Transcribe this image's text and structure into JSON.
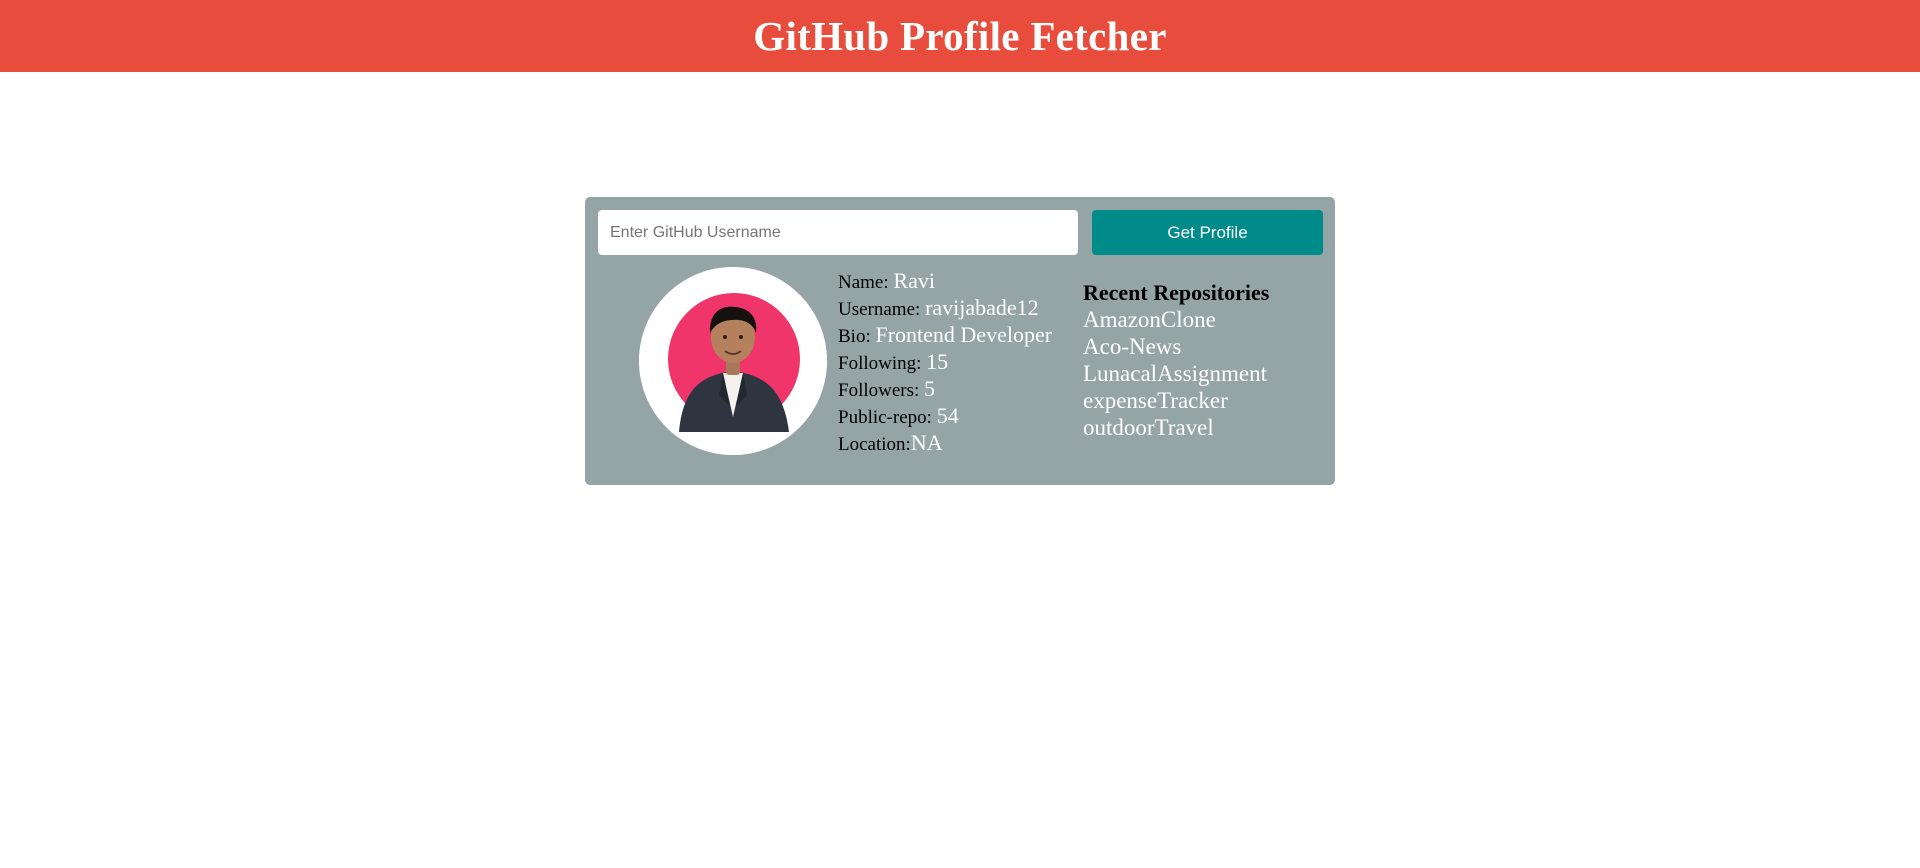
{
  "header": {
    "title": "GitHub Profile Fetcher"
  },
  "search": {
    "placeholder": "Enter GitHub Username",
    "value": "",
    "button_label": "Get Profile"
  },
  "profile": {
    "avatar_icon": "profile-photo",
    "fields": [
      {
        "label": "Name: ",
        "value": "Ravi"
      },
      {
        "label": "Username: ",
        "value": "ravijabade12"
      },
      {
        "label": "Bio: ",
        "value": "Frontend Developer"
      },
      {
        "label": "Following: ",
        "value": "15"
      },
      {
        "label": "Followers: ",
        "value": "5"
      },
      {
        "label": "Public-repo: ",
        "value": "54"
      },
      {
        "label": "Location:",
        "value": "NA"
      }
    ]
  },
  "repositories": {
    "title": "Recent Repositories",
    "items": [
      "AmazonClone",
      "Aco-News",
      "LunacalAssignment",
      "expenseTracker",
      "outdoorTravel"
    ]
  },
  "colors": {
    "header_bg": "#e74c3c",
    "card_bg": "#95a5a6",
    "button_bg": "#008b8b",
    "avatar_accent": "#f0356b"
  }
}
